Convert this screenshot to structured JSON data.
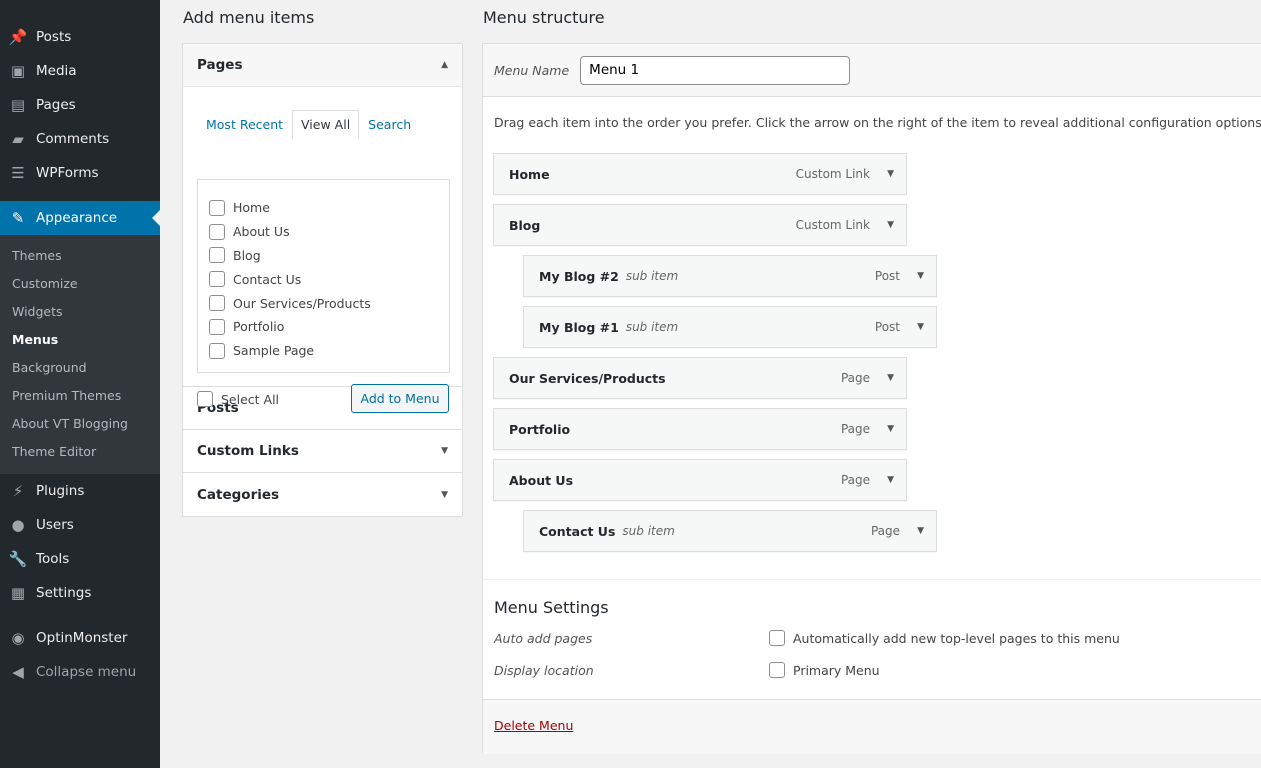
{
  "sidebar": {
    "items_top": [
      {
        "label": "Posts",
        "icon": "pin-icon"
      },
      {
        "label": "Media",
        "icon": "media-icon"
      },
      {
        "label": "Pages",
        "icon": "pages-icon"
      },
      {
        "label": "Comments",
        "icon": "comment-icon"
      },
      {
        "label": "WPForms",
        "icon": "forms-icon"
      }
    ],
    "active": {
      "label": "Appearance",
      "icon": "brush-icon"
    },
    "submenu": [
      "Themes",
      "Customize",
      "Widgets",
      "Menus",
      "Background",
      "Premium Themes",
      "About VT Blogging",
      "Theme Editor"
    ],
    "current_sub": "Menus",
    "items_bottom": [
      {
        "label": "Plugins",
        "icon": "plug-icon"
      },
      {
        "label": "Users",
        "icon": "user-icon"
      },
      {
        "label": "Tools",
        "icon": "wrench-icon"
      },
      {
        "label": "Settings",
        "icon": "settings-icon"
      },
      {
        "label": "OptinMonster",
        "icon": "optinmonster-icon"
      },
      {
        "label": "Collapse menu",
        "icon": "collapse-icon"
      }
    ],
    "accent": "#0073aa"
  },
  "left": {
    "title": "Add menu items",
    "pages_title": "Pages",
    "tabs": [
      "Most Recent",
      "View All",
      "Search"
    ],
    "selected_tab": "View All",
    "pages": [
      "Home",
      "About Us",
      "Blog",
      "Contact Us",
      "Our Services/Products",
      "Portfolio",
      "Sample Page"
    ],
    "select_all": "Select All",
    "add_button": "Add to Menu",
    "sections": [
      "Posts",
      "Custom Links",
      "Categories"
    ]
  },
  "right": {
    "title": "Menu structure",
    "name_label": "Menu Name",
    "name_value": "Menu 1",
    "instructions": "Drag each item into the order you prefer. Click the arrow on the right of the item to reveal additional configuration options.",
    "items": [
      {
        "title": "Home",
        "type": "Custom Link",
        "sub": ""
      },
      {
        "title": "Blog",
        "type": "Custom Link",
        "sub": ""
      },
      {
        "title": "My Blog #2",
        "type": "Post",
        "sub": "sub item"
      },
      {
        "title": "My Blog #1",
        "type": "Post",
        "sub": "sub item"
      },
      {
        "title": "Our Services/Products",
        "type": "Page",
        "sub": ""
      },
      {
        "title": "Portfolio",
        "type": "Page",
        "sub": ""
      },
      {
        "title": "About Us",
        "type": "Page",
        "sub": ""
      },
      {
        "title": "Contact Us",
        "type": "Page",
        "sub": "sub item"
      }
    ],
    "settings": {
      "title": "Menu Settings",
      "auto_label": "Auto add pages",
      "auto_option": "Automatically add new top-level pages to this menu",
      "location_label": "Display location",
      "location_option": "Primary Menu"
    },
    "delete": "Delete Menu"
  }
}
